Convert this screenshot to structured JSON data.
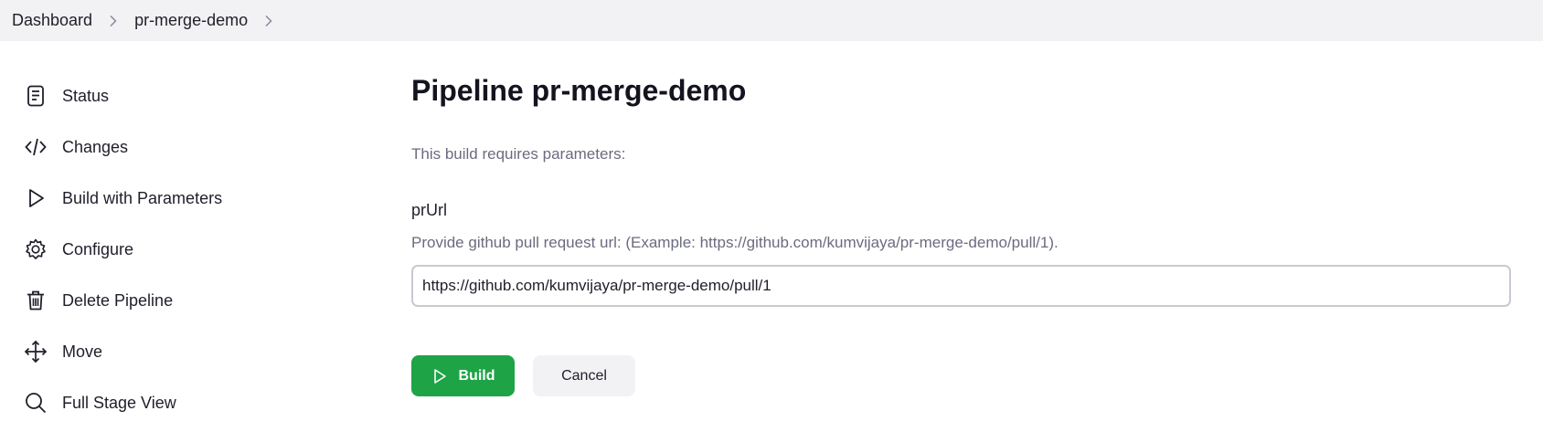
{
  "breadcrumb": {
    "items": [
      {
        "label": "Dashboard"
      },
      {
        "label": "pr-merge-demo"
      }
    ]
  },
  "sidebar": {
    "items": [
      {
        "label": "Status",
        "icon": "document-icon"
      },
      {
        "label": "Changes",
        "icon": "code-icon"
      },
      {
        "label": "Build with Parameters",
        "icon": "play-icon"
      },
      {
        "label": "Configure",
        "icon": "gear-icon"
      },
      {
        "label": "Delete Pipeline",
        "icon": "trash-icon"
      },
      {
        "label": "Move",
        "icon": "move-icon"
      },
      {
        "label": "Full Stage View",
        "icon": "search-icon"
      }
    ]
  },
  "main": {
    "title": "Pipeline pr-merge-demo",
    "requires_text": "This build requires parameters:",
    "parameter": {
      "name": "prUrl",
      "description": "Provide github pull request url: (Example: https://github.com/kumvijaya/pr-merge-demo/pull/1).",
      "value": "https://github.com/kumvijaya/pr-merge-demo/pull/1"
    },
    "build_label": "Build",
    "cancel_label": "Cancel"
  },
  "colors": {
    "primary_button": "#1ea446",
    "breadcrumb_bg": "#f2f2f4",
    "muted_text": "#6b6b80"
  }
}
